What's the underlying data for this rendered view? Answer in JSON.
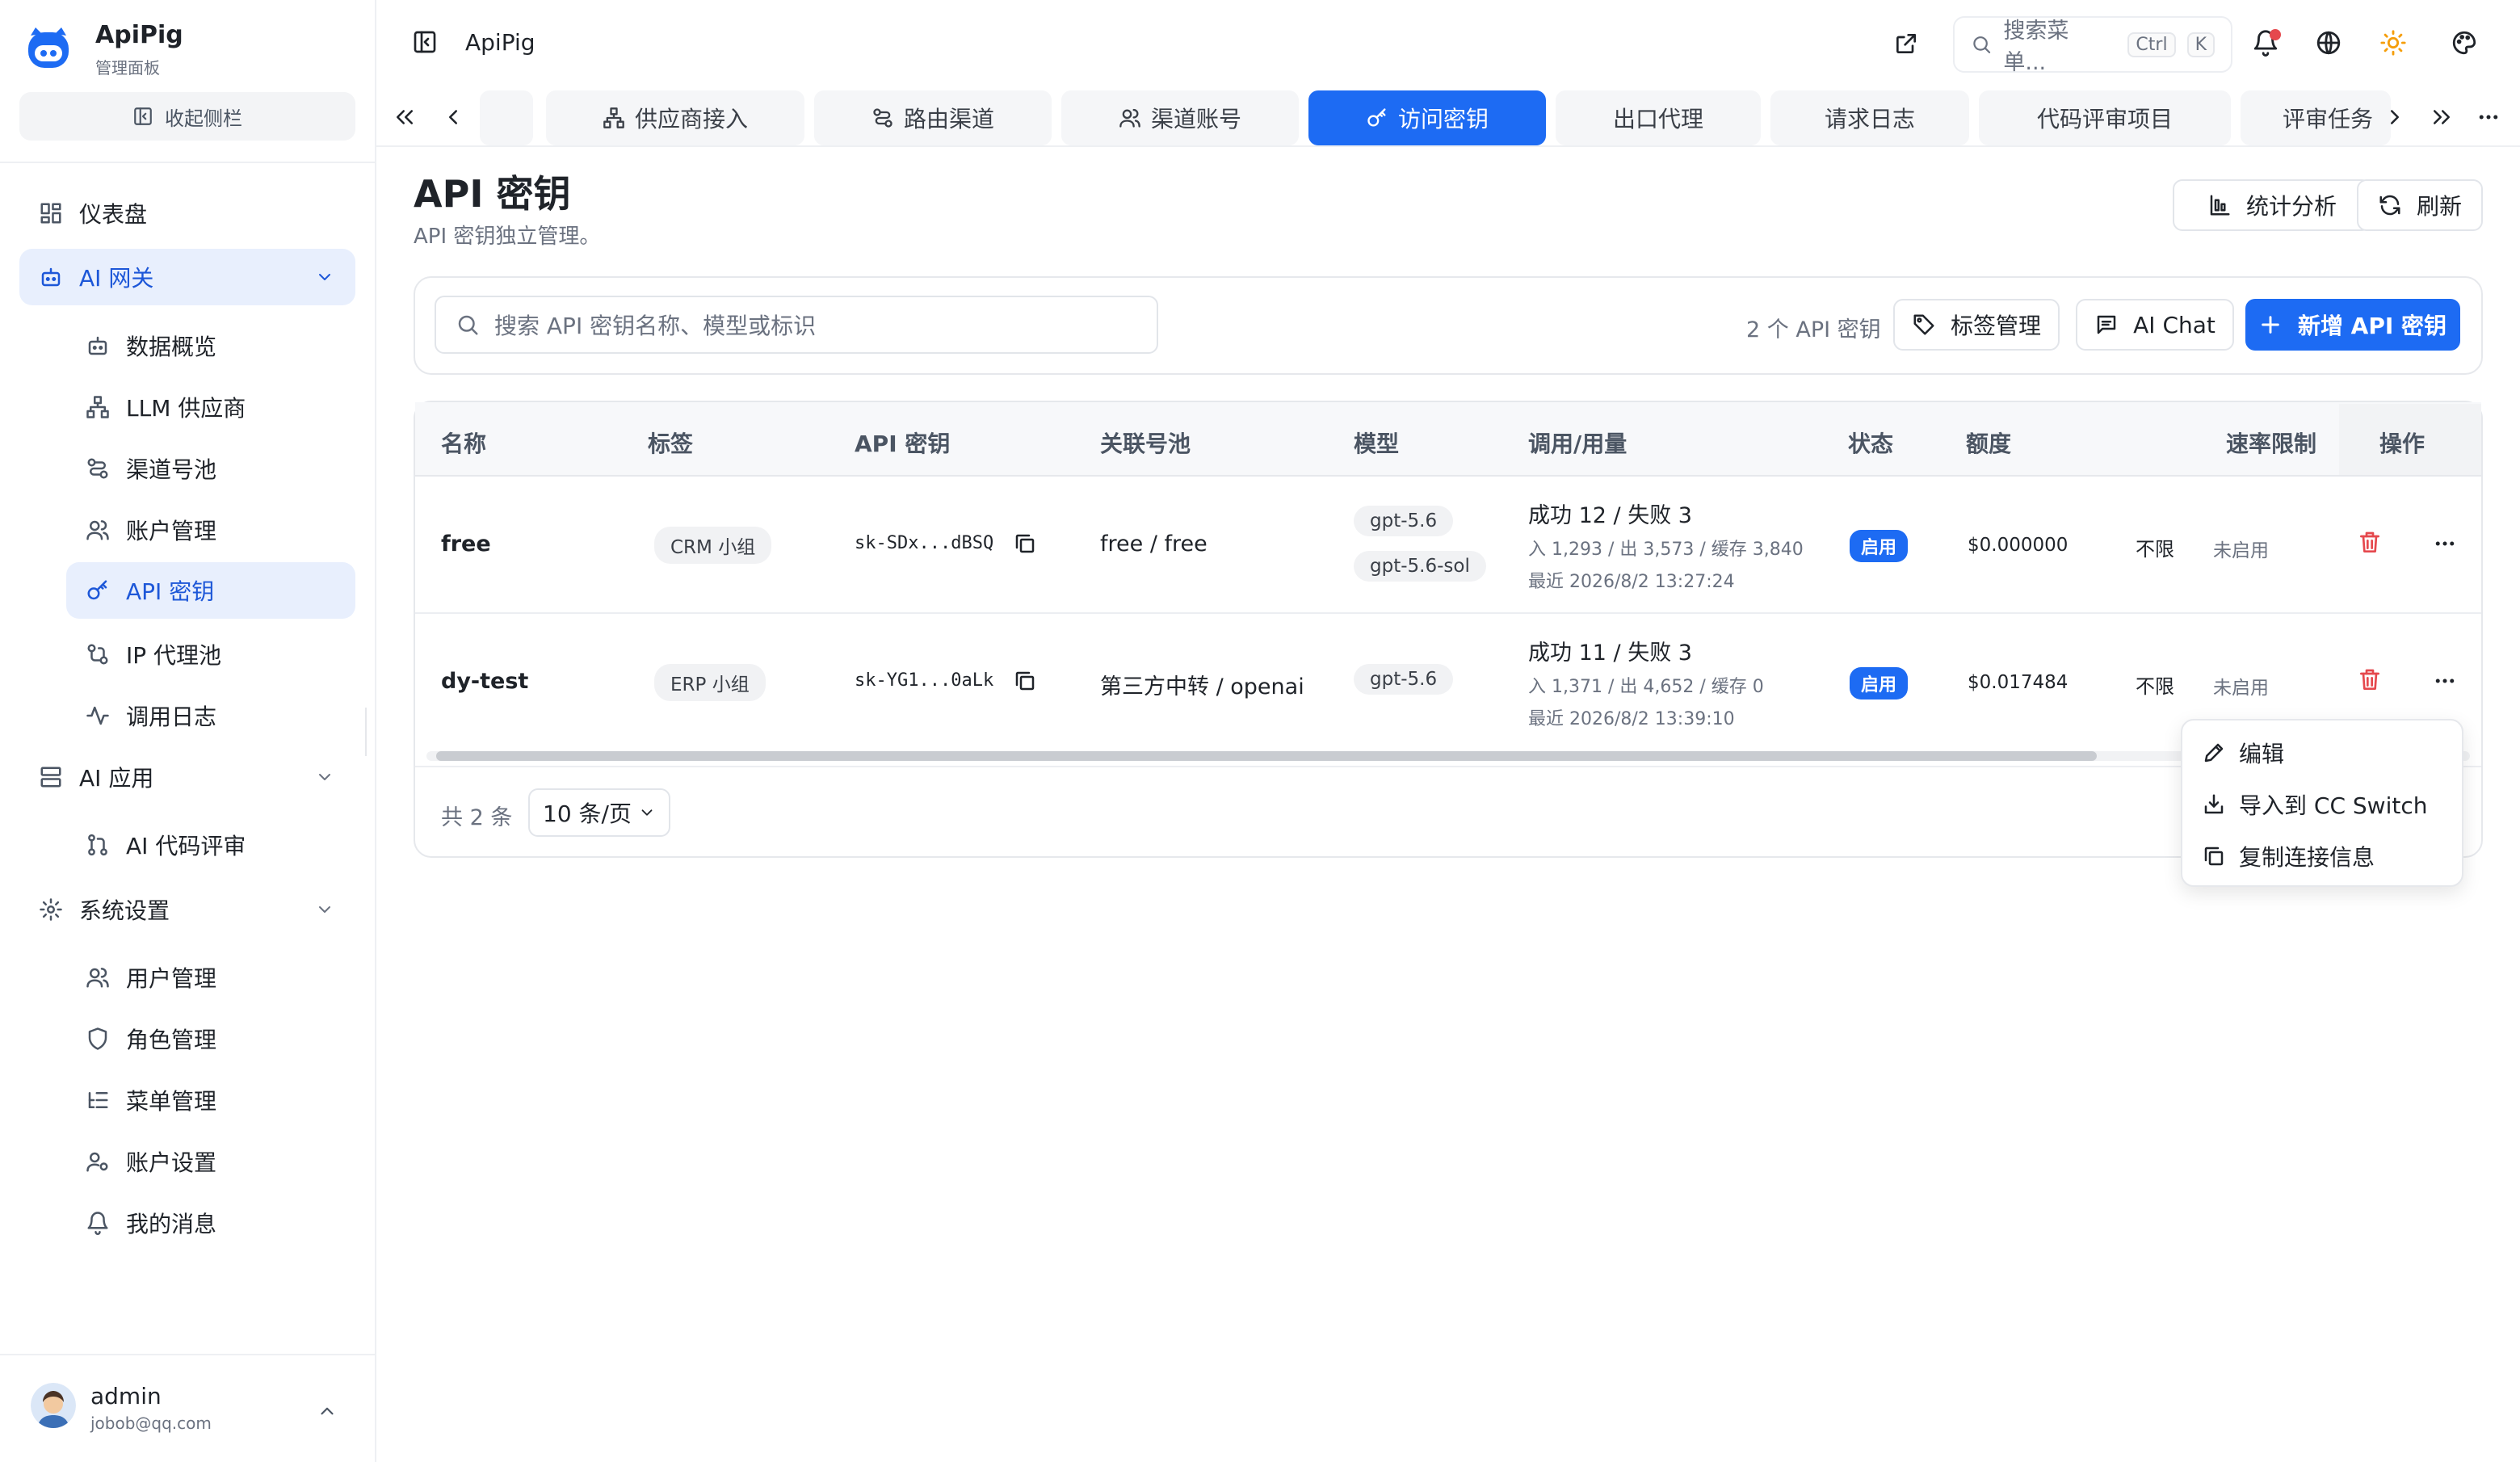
{
  "app": {
    "name": "ApiPig",
    "subtitle": "管理面板",
    "collapse_label": "收起侧栏"
  },
  "sidebar": {
    "dashboard": "仪表盘",
    "ai_gateway": "AI 网关",
    "gateway_items": [
      "数据概览",
      "LLM 供应商",
      "渠道号池",
      "账户管理",
      "API 密钥",
      "IP 代理池",
      "调用日志"
    ],
    "ai_apps": "AI 应用",
    "app_items": [
      "AI 代码评审"
    ],
    "system": "系统设置",
    "system_items": [
      "用户管理",
      "角色管理",
      "菜单管理",
      "账户设置",
      "我的消息"
    ]
  },
  "user": {
    "name": "admin",
    "email": "jobob@qq.com"
  },
  "header": {
    "breadcrumb": "ApiPig",
    "search_placeholder": "搜索菜单...",
    "kbd_ctrl": "Ctrl",
    "kbd_k": "K"
  },
  "tabs": [
    "供应商接入",
    "路由渠道",
    "渠道账号",
    "访问密钥",
    "出口代理",
    "请求日志",
    "代码评审项目",
    "评审任务"
  ],
  "page": {
    "title": "API 密钥",
    "subtitle": "API 密钥独立管理。",
    "stats_label": "统计分析",
    "refresh_label": "刷新"
  },
  "toolbar": {
    "search_placeholder": "搜索 API 密钥名称、模型或标识",
    "count_text": "2 个 API 密钥",
    "tags_label": "标签管理",
    "chat_label": "AI Chat",
    "new_label": "新增 API 密钥"
  },
  "table": {
    "headers": [
      "名称",
      "标签",
      "API 密钥",
      "关联号池",
      "模型",
      "调用/用量",
      "状态",
      "额度",
      "速率限制",
      "操作"
    ],
    "rows": [
      {
        "name": "free",
        "tag": "CRM 小组",
        "key": "sk-SDx...dBSQ",
        "pool": "free / free",
        "models": [
          "gpt-5.6",
          "gpt-5.6-sol"
        ],
        "usage_main": "成功 12 / 失败 3",
        "usage_io": "入 1,293 / 出 3,573 / 缓存 3,840",
        "usage_last": "最近 2026/8/2 13:27:24",
        "status": "启用",
        "quota": "$0.000000",
        "limit": "不限",
        "rate": "未启用"
      },
      {
        "name": "dy-test",
        "tag": "ERP 小组",
        "key": "sk-YG1...0aLk",
        "pool": "第三方中转 / openai",
        "models": [
          "gpt-5.6"
        ],
        "usage_main": "成功 11 / 失败 3",
        "usage_io": "入 1,371 / 出 4,652 / 缓存 0",
        "usage_last": "最近 2026/8/2 13:39:10",
        "status": "启用",
        "quota": "$0.017484",
        "limit": "不限",
        "rate": "未启用"
      }
    ]
  },
  "pagination": {
    "total": "共 2 条",
    "page_size": "10 条/页"
  },
  "context_menu": [
    "编辑",
    "导入到 CC Switch",
    "复制连接信息"
  ],
  "colors": {
    "primary": "#1d6bf3",
    "danger": "#e5484d"
  }
}
